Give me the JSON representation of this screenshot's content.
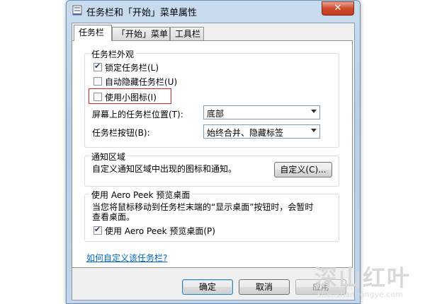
{
  "window": {
    "title": "任务栏和「开始」菜单属性",
    "close_label": "✕"
  },
  "tabs": [
    {
      "label": "任务栏"
    },
    {
      "label": "「开始」菜单"
    },
    {
      "label": "工具栏"
    }
  ],
  "appearance": {
    "group_label": "任务栏外观",
    "lock_taskbar": {
      "label": "锁定任务栏(L)",
      "checked": true
    },
    "auto_hide": {
      "label": "自动隐藏任务栏(U)",
      "checked": false
    },
    "small_icons": {
      "label": "使用小图标(I)",
      "checked": false
    },
    "location_label": "屏幕上的任务栏位置(T):",
    "location_value": "底部",
    "buttons_label": "任务栏按钮(B):",
    "buttons_value": "始终合并、隐藏标签"
  },
  "notification": {
    "group_label": "通知区域",
    "description": "自定义通知区域中出现的图标和通知。",
    "customize_button": "自定义(C)..."
  },
  "aero_peek": {
    "group_label": "使用 Aero Peek 预览桌面",
    "description_line1": "当您将鼠标移动到任务栏末端的“显示桌面”按钮时，会暂时",
    "description_line2": "查看桌面。",
    "checkbox": {
      "label": "使用 Aero Peek 预览桌面(P)",
      "checked": true
    }
  },
  "help_link": "如何自定义该任务栏?",
  "buttons": {
    "ok": "确定",
    "cancel": "取消",
    "apply": "应用"
  },
  "watermark": {
    "main": "深山红叶",
    "sub": "shenshanhongye.com"
  }
}
